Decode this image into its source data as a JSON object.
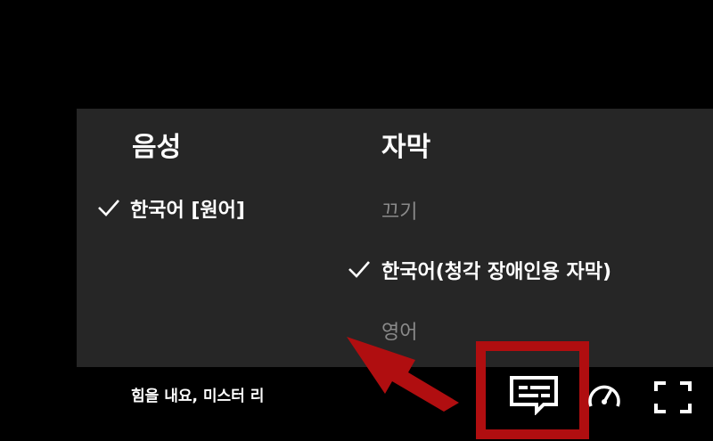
{
  "audio": {
    "title": "음성",
    "options": [
      {
        "label": "한국어 [원어]",
        "selected": true
      }
    ]
  },
  "subtitles": {
    "title": "자막",
    "options": [
      {
        "label": "끄기",
        "selected": false
      },
      {
        "label": "한국어(청각 장애인용 자막)",
        "selected": true
      },
      {
        "label": "영어",
        "selected": false
      }
    ]
  },
  "player": {
    "episode_title": "힘을 내요, 미스터 리",
    "controls": [
      "subtitles-audio-icon",
      "playback-speed-icon",
      "fullscreen-icon"
    ]
  },
  "colors": {
    "panel_bg": "#262626",
    "annotation_red": "#b00e10",
    "dim_text": "#8a8a8a"
  }
}
